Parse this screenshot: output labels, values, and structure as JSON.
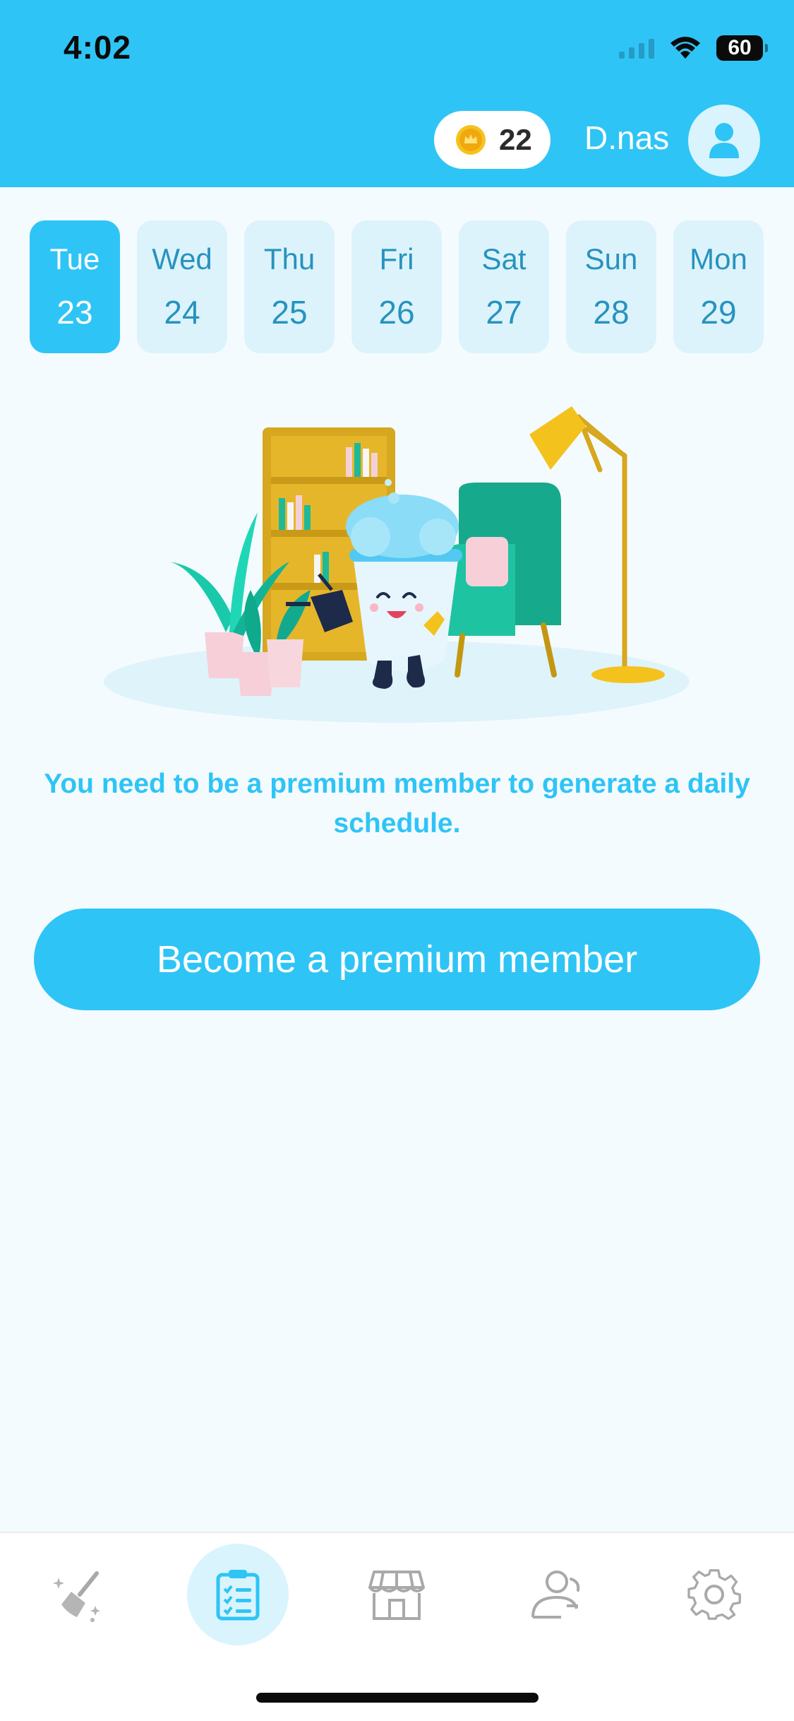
{
  "status_bar": {
    "time": "4:02",
    "battery": "60"
  },
  "header": {
    "coins": "22",
    "username": "D.nas"
  },
  "days": [
    {
      "name": "Tue",
      "num": "23",
      "active": true
    },
    {
      "name": "Wed",
      "num": "24",
      "active": false
    },
    {
      "name": "Thu",
      "num": "25",
      "active": false
    },
    {
      "name": "Fri",
      "num": "26",
      "active": false
    },
    {
      "name": "Sat",
      "num": "27",
      "active": false
    },
    {
      "name": "Sun",
      "num": "28",
      "active": false
    },
    {
      "name": "Mon",
      "num": "29",
      "active": false
    }
  ],
  "main": {
    "message": "You need to be a premium member to generate a daily schedule.",
    "cta_label": "Become a premium member"
  },
  "tabbar": {
    "items": [
      {
        "icon": "broom-icon",
        "active": false
      },
      {
        "icon": "clipboard-checklist-icon",
        "active": true
      },
      {
        "icon": "shop-icon",
        "active": false
      },
      {
        "icon": "users-icon",
        "active": false
      },
      {
        "icon": "gear-icon",
        "active": false
      }
    ]
  },
  "colors": {
    "accent": "#2fc4f6",
    "day_bg": "#dcf3fc",
    "day_text": "#2793be",
    "background": "#f4fbfe"
  }
}
